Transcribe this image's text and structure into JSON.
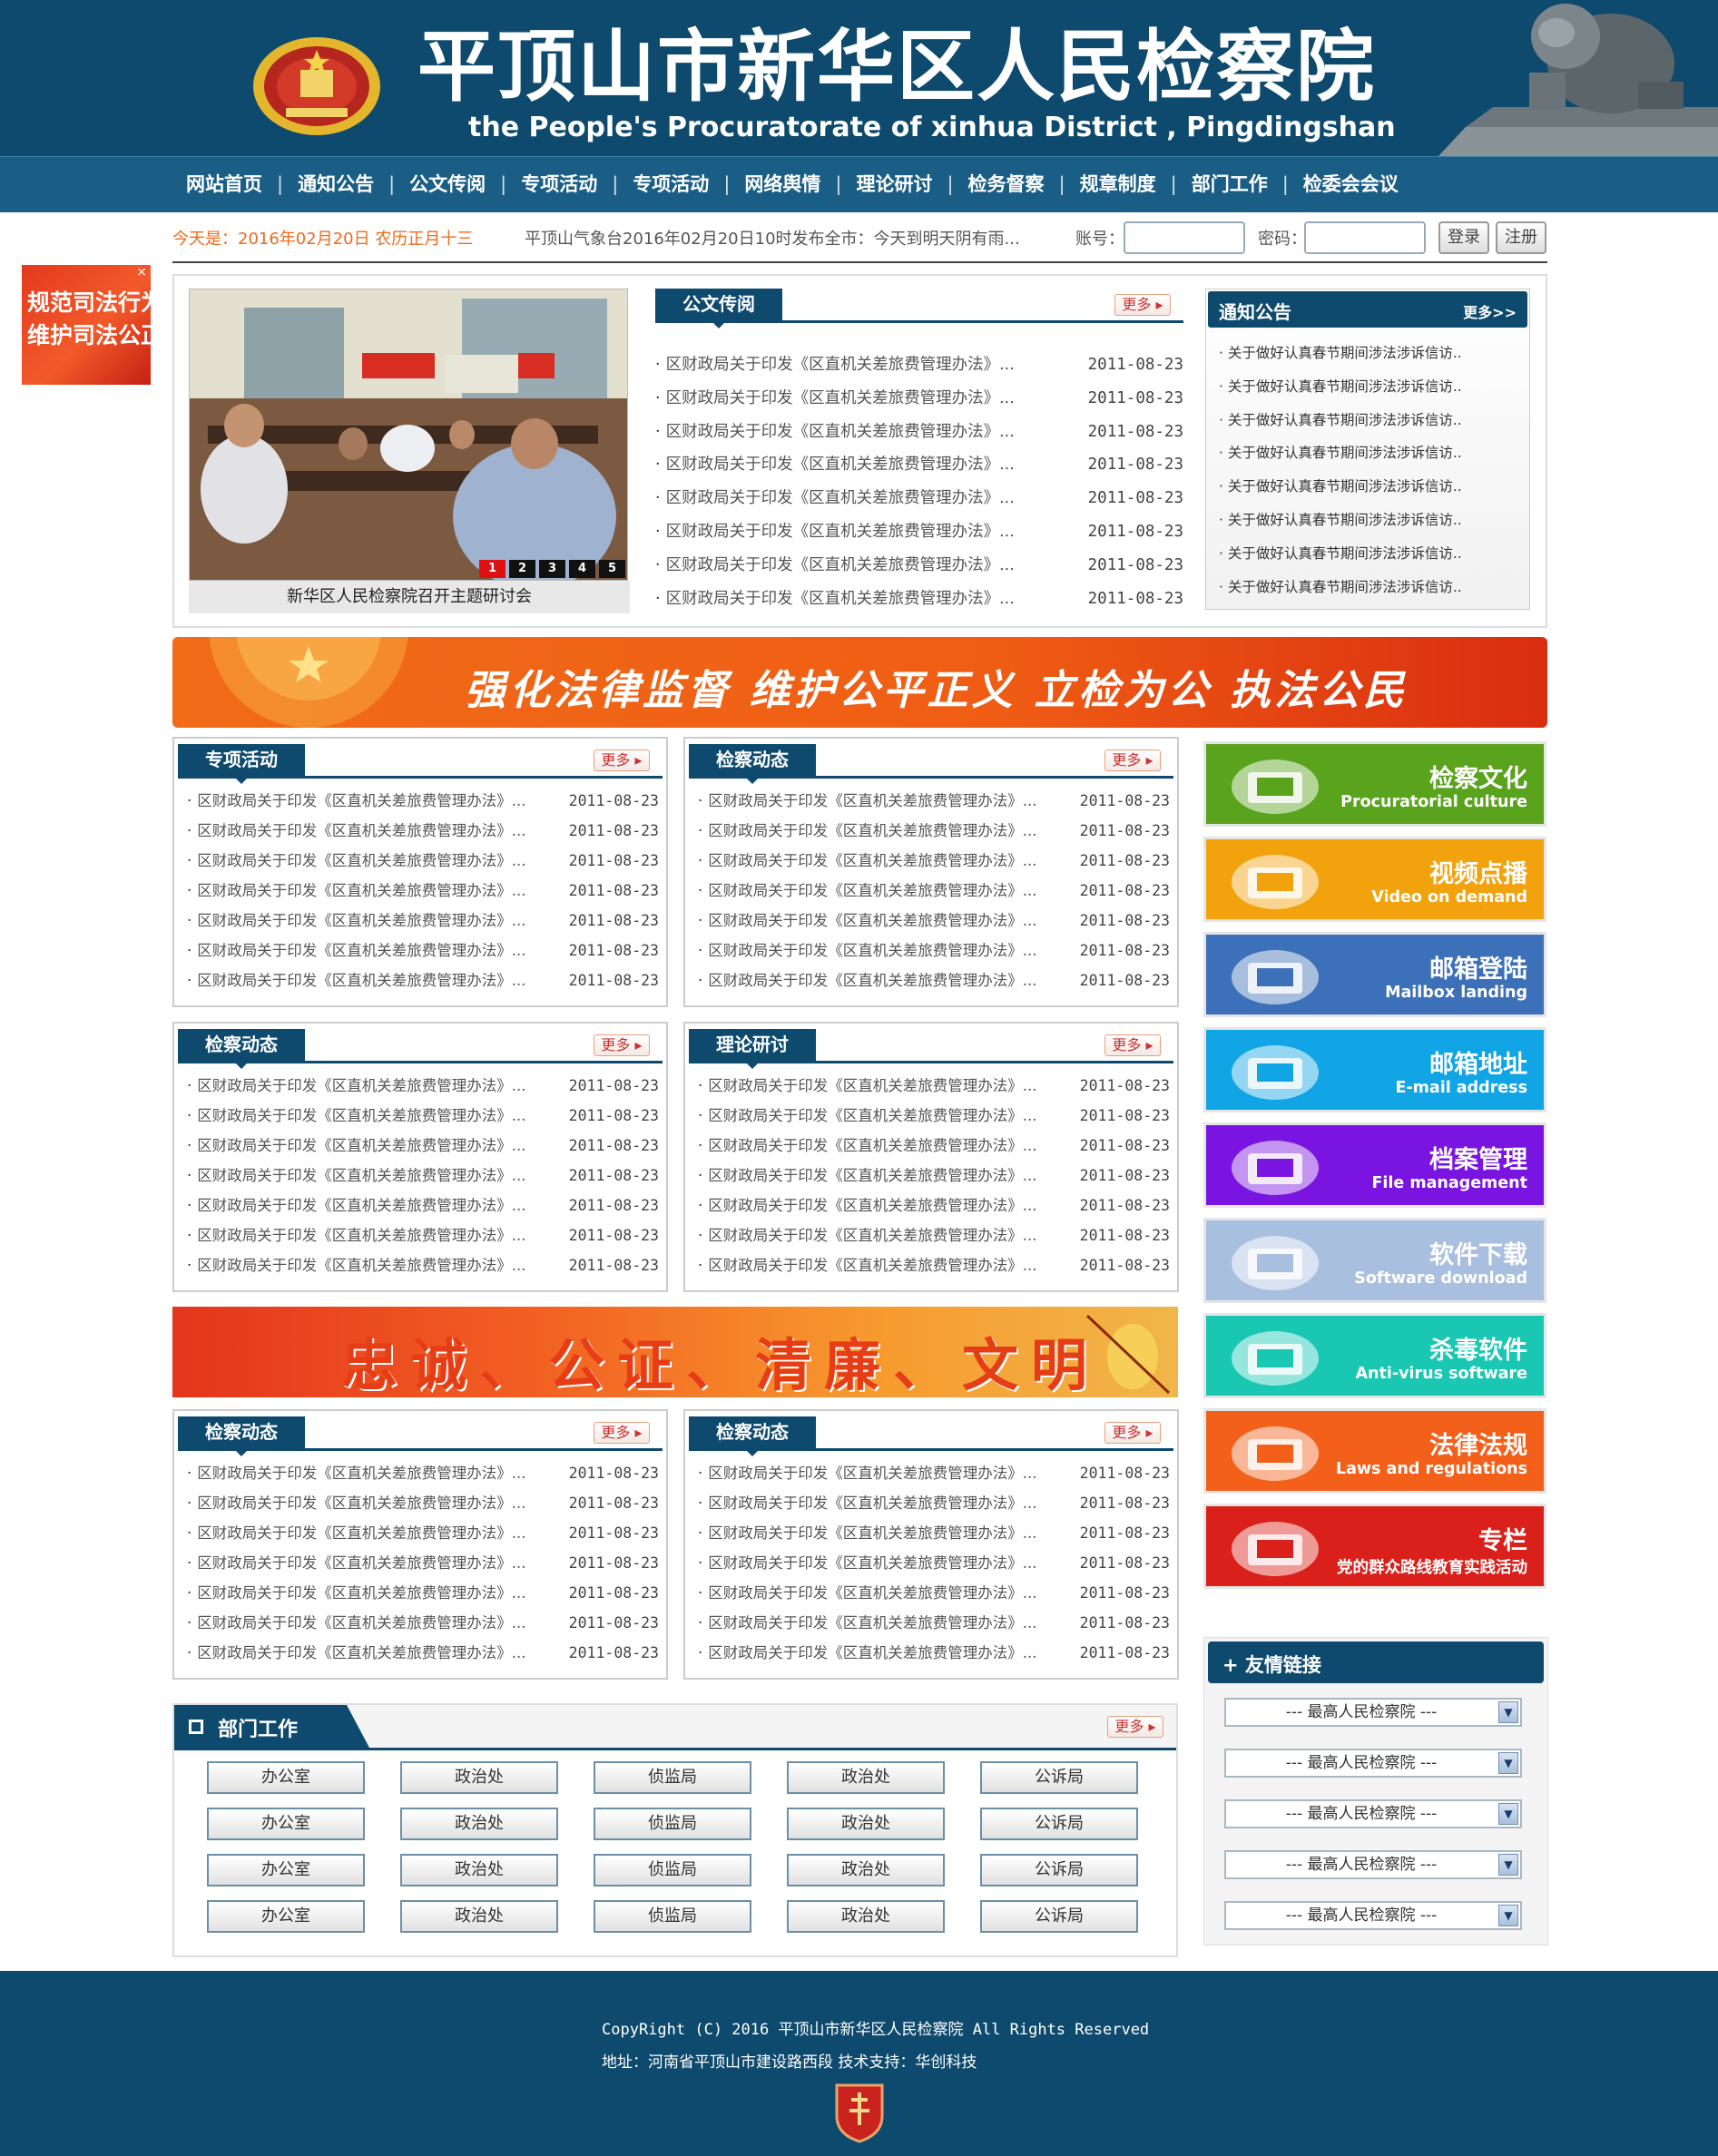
{
  "header": {
    "title": "平顶山市新华区人民检察院",
    "subtitle": "the People's Procuratorate of xinhua District , Pingdingshan"
  },
  "nav": [
    "网站首页",
    "通知公告",
    "公文传阅",
    "专项活动",
    "专项活动",
    "网络舆情",
    "理论研讨",
    "检务督察",
    "规章制度",
    "部门工作",
    "检委会会议"
  ],
  "nav_separator": "|",
  "info": {
    "today": "今天是：2016年02月20日 农历正月十三",
    "weather": "平顶山气象台2016年02月20日10时发布全市：今天到明天阴有雨...",
    "account_label": "账号：",
    "password_label": "密码：",
    "login": "登录",
    "register": "注册"
  },
  "float_ad": {
    "text": "规范司法行为\n维护司法公正",
    "close": "×"
  },
  "slideshow": {
    "caption": "新华区人民检察院召开主题研讨会",
    "pages": [
      "1",
      "2",
      "3",
      "4",
      "5"
    ],
    "active_page": 1
  },
  "gov_docs": {
    "title": "公文传阅",
    "more": "更多",
    "items": [
      {
        "title": "区财政局关于印发《区直机关差旅费管理办法》...",
        "date": "2011-08-23"
      },
      {
        "title": "区财政局关于印发《区直机关差旅费管理办法》...",
        "date": "2011-08-23"
      },
      {
        "title": "区财政局关于印发《区直机关差旅费管理办法》...",
        "date": "2011-08-23"
      },
      {
        "title": "区财政局关于印发《区直机关差旅费管理办法》...",
        "date": "2011-08-23"
      },
      {
        "title": "区财政局关于印发《区直机关差旅费管理办法》...",
        "date": "2011-08-23"
      },
      {
        "title": "区财政局关于印发《区直机关差旅费管理办法》...",
        "date": "2011-08-23"
      },
      {
        "title": "区财政局关于印发《区直机关差旅费管理办法》...",
        "date": "2011-08-23"
      },
      {
        "title": "区财政局关于印发《区直机关差旅费管理办法》...",
        "date": "2011-08-23"
      }
    ]
  },
  "notice": {
    "title": "通知公告",
    "more": "更多>>",
    "items": [
      "关于做好认真春节期间涉法涉诉信访..",
      "关于做好认真春节期间涉法涉诉信访..",
      "关于做好认真春节期间涉法涉诉信访..",
      "关于做好认真春节期间涉法涉诉信访..",
      "关于做好认真春节期间涉法涉诉信访..",
      "关于做好认真春节期间涉法涉诉信访..",
      "关于做好认真春节期间涉法涉诉信访..",
      "关于做好认真春节期间涉法涉诉信访.."
    ]
  },
  "banner1": "强化法律监督  维护公平正义  立检为公  执法公民",
  "banner2": "忠诚、公证、清廉、文明",
  "news_boxes": [
    {
      "title": "专项活动",
      "more": "更多"
    },
    {
      "title": "检察动态",
      "more": "更多"
    },
    {
      "title": "检察动态",
      "more": "更多"
    },
    {
      "title": "理论研讨",
      "more": "更多"
    },
    {
      "title": "检察动态",
      "more": "更多"
    },
    {
      "title": "检察动态",
      "more": "更多"
    }
  ],
  "news_item": {
    "title": "区财政局关于印发《区直机关差旅费管理办法》...",
    "date": "2011-08-23"
  },
  "tiles": [
    {
      "cn": "检察文化",
      "en": "Procuratorial culture",
      "color": "#5aa31c",
      "icon": "open-book-icon"
    },
    {
      "cn": "视频点播",
      "en": "Video on demand",
      "color": "#f2a20c",
      "icon": "laptop-icon"
    },
    {
      "cn": "邮箱登陆",
      "en": "Mailbox landing",
      "color": "#3c70b8",
      "icon": "mailbox-icon"
    },
    {
      "cn": "邮箱地址",
      "en": "E-mail address",
      "color": "#12a5e6",
      "icon": "globe-icon"
    },
    {
      "cn": "档案管理",
      "en": "File management",
      "color": "#7a14e0",
      "icon": "clipboard-icon"
    },
    {
      "cn": "软件下载",
      "en": "Software download",
      "color": "#a9bfe0",
      "icon": "download-icon"
    },
    {
      "cn": "杀毒软件",
      "en": "Anti-virus software",
      "color": "#19c7b3",
      "icon": "shield-icon"
    },
    {
      "cn": "法律法规",
      "en": "Laws and regulations",
      "color": "#f3601a",
      "icon": "law-book-icon"
    },
    {
      "cn": "专栏",
      "en": "党的群众路线教育实践活动",
      "color": "#d9201a",
      "icon": "flag-icon"
    }
  ],
  "links": {
    "title": "友情链接",
    "options": [
      "--- 最高人民检察院 ---",
      "--- 最高人民检察院 ---",
      "--- 最高人民检察院 ---",
      "--- 最高人民检察院 ---",
      "--- 最高人民检察院 ---"
    ]
  },
  "departments": {
    "title": "部门工作",
    "more": "更多",
    "rows": [
      [
        "办公室",
        "政治处",
        "侦监局",
        "政治处",
        "公诉局"
      ],
      [
        "办公室",
        "政治处",
        "侦监局",
        "政治处",
        "公诉局"
      ],
      [
        "办公室",
        "政治处",
        "侦监局",
        "政治处",
        "公诉局"
      ],
      [
        "办公室",
        "政治处",
        "侦监局",
        "政治处",
        "公诉局"
      ]
    ]
  },
  "footer": {
    "copyright": "CopyRight (C) 2016 平顶山市新华区人民检察院 All Rights Reserved",
    "address": "地址：河南省平顶山市建设路西段 技术支持：华创科技"
  }
}
